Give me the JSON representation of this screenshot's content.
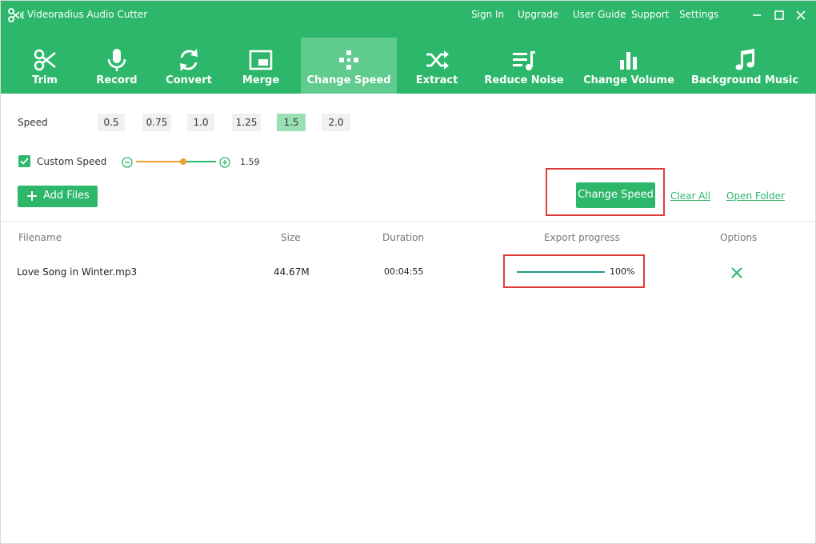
{
  "app": {
    "title": "Videoradius Audio Cutter"
  },
  "top_links": {
    "sign_in": "Sign In",
    "upgrade": "Upgrade",
    "user_guide": "User Guide",
    "support": "Support",
    "settings": "Settings"
  },
  "toolbar": {
    "items": [
      {
        "label": "Trim",
        "icon": "scissors-icon"
      },
      {
        "label": "Record",
        "icon": "microphone-icon"
      },
      {
        "label": "Convert",
        "icon": "convert-arrows-icon"
      },
      {
        "label": "Merge",
        "icon": "merge-icon"
      },
      {
        "label": "Change Speed",
        "icon": "gamepad-icon"
      },
      {
        "label": "Extract",
        "icon": "shuffle-icon"
      },
      {
        "label": "Reduce Noise",
        "icon": "noise-list-icon"
      },
      {
        "label": "Change Volume",
        "icon": "volume-bars-icon"
      },
      {
        "label": "Background Music",
        "icon": "music-note-icon"
      }
    ],
    "active_index": 4
  },
  "speed": {
    "label": "Speed",
    "options": [
      "0.5",
      "0.75",
      "1.0",
      "1.25",
      "1.5",
      "2.0"
    ],
    "selected": "1.5"
  },
  "custom_speed": {
    "label": "Custom Speed",
    "checked": true,
    "value": "1.59",
    "slider_fraction": 0.59
  },
  "actions": {
    "add_files": "Add Files",
    "change_speed": "Change Speed",
    "clear_all": "Clear All",
    "open_folder": "Open Folder"
  },
  "table": {
    "headers": {
      "filename": "Filename",
      "size": "Size",
      "duration": "Duration",
      "export_progress": "Export progress",
      "options": "Options"
    },
    "rows": [
      {
        "filename": "Love Song in Winter.mp3",
        "size": "44.67M",
        "duration": "00:04:55",
        "progress_text": "100%",
        "progress": 1.0
      }
    ]
  },
  "colors": {
    "brand": "#2db76a",
    "active_tab": "#5fcb8e",
    "highlight": "#e23b3b",
    "slider": "#f0a02a",
    "progress": "#1a9a88"
  }
}
